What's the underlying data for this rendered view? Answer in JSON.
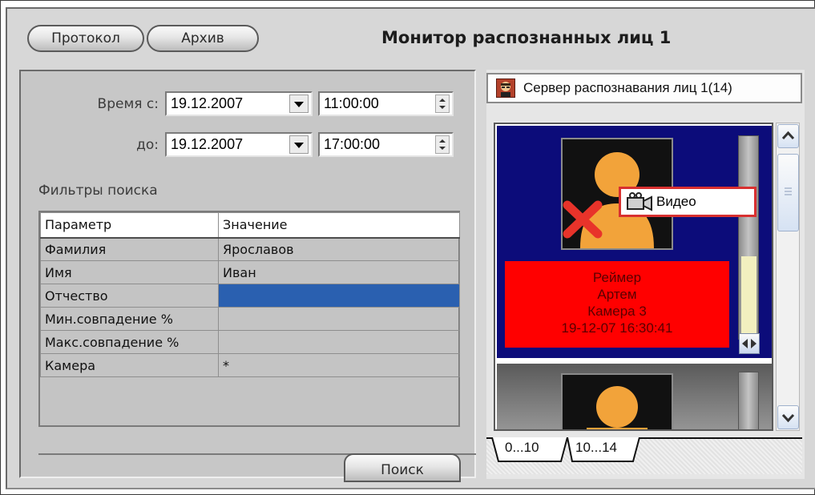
{
  "header": {
    "protocol_button": "Протокол",
    "archive_button": "Архив",
    "title": "Монитор распознанных лиц 1"
  },
  "search": {
    "time_from_label": "Время с:",
    "time_to_label": "до:",
    "date_from": "19.12.2007",
    "time_from": "11:00:00",
    "date_to": "19.12.2007",
    "time_to": "17:00:00",
    "filters_label": "Фильтры поиска",
    "search_button": "Поиск"
  },
  "filters_table": {
    "columns": [
      "Параметр",
      "Значение"
    ],
    "rows": [
      {
        "param": "Фамилия",
        "value": "Ярославов"
      },
      {
        "param": "Имя",
        "value": "Иван"
      },
      {
        "param": "Отчество",
        "value": ""
      },
      {
        "param": "Мин.совпадение %",
        "value": ""
      },
      {
        "param": "Макс.совпадение %",
        "value": ""
      },
      {
        "param": "Камера",
        "value": "*"
      }
    ],
    "selected_row": 2
  },
  "server": {
    "label": "Сервер распознавания лиц 1(14)",
    "icon": "face-server-icon"
  },
  "results": {
    "card1": {
      "last_name": "Реймер",
      "first_name": "Артем",
      "camera": "Камера 3",
      "datetime": "19-12-07 16:30:41"
    },
    "context_menu_item": "Видео",
    "tabs": [
      "0...10",
      "10...14"
    ],
    "active_tab": 0
  },
  "colors": {
    "card_background": "#0c0c7a",
    "alert_background": "#ff0000",
    "selection": "#2a60b0"
  }
}
